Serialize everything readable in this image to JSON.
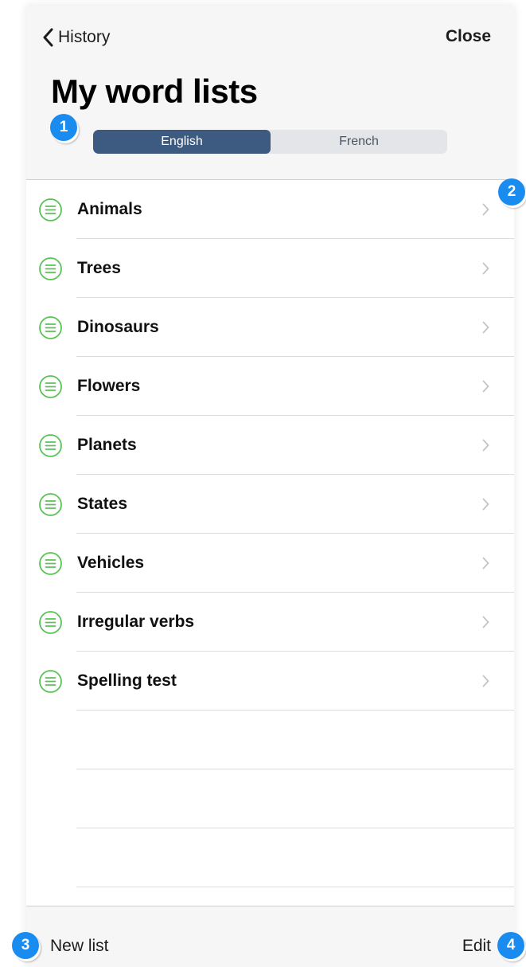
{
  "header": {
    "back_label": "History",
    "close_label": "Close",
    "title": "My word lists"
  },
  "language_toggle": {
    "options": [
      "English",
      "French"
    ],
    "selected": "English"
  },
  "word_lists": [
    "Animals",
    "Trees",
    "Dinosaurs",
    "Flowers",
    "Planets",
    "States",
    "Vehicles",
    "Irregular verbs",
    "Spelling test"
  ],
  "toolbar": {
    "new_list_label": "New list",
    "edit_label": "Edit"
  },
  "callouts": [
    "1",
    "2",
    "3",
    "4"
  ],
  "icons": {
    "back": "chevron-left-icon",
    "list": "list-circle-icon",
    "row_disclosure": "chevron-right-icon"
  },
  "colors": {
    "segment_selected": "#3d5a80",
    "list_icon": "#5cc15a",
    "callout": "#1a8cf0"
  }
}
